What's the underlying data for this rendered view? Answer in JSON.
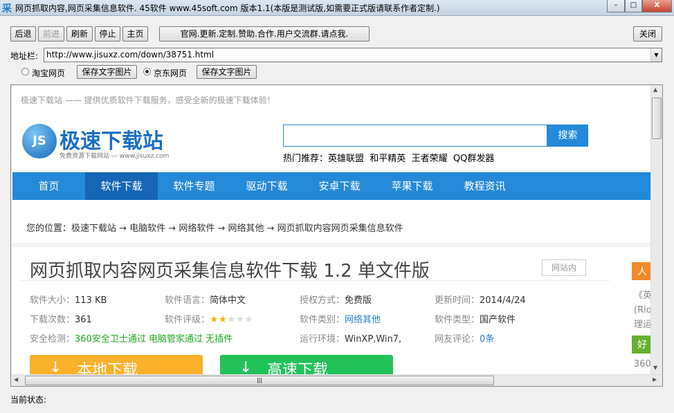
{
  "window": {
    "title": "网页抓取内容,网页采集信息软件. 45软件 www.45soft.com 版本1.1(本版是测试版,如需要正式版请联系作者定制.)",
    "icon": "采",
    "min": "–",
    "max": "□",
    "close": "X"
  },
  "toolbar": {
    "back": "后退",
    "forward": "前进",
    "refresh": "刷新",
    "stop": "停止",
    "home": "主页",
    "promo": "官网.更新.定制.赞助.合作.用户交流群.请点我.",
    "close": "关闭"
  },
  "address": {
    "label": "地址栏:",
    "value": "http://www.jisuxz.com/down/38751.html"
  },
  "options": {
    "taobao": "淘宝网页",
    "save1": "保存文字图片",
    "jd": "京东网页",
    "save2": "保存文字图片",
    "selected": "jd"
  },
  "page": {
    "tagline": "极速下载站 —— 提供优质软件下载服务，感受全新的极速下载体验！",
    "logo": {
      "badge": "JS",
      "name": "极速下载站",
      "sub": "免费资源下载网站 — www.jisuxz.com"
    },
    "search": {
      "placeholder": "",
      "button": "搜索"
    },
    "hot": {
      "label": "热门推荐：",
      "items": [
        "英雄联盟",
        "和平精英",
        "王者荣耀",
        "QQ群发器"
      ]
    },
    "nav": [
      "首页",
      "软件下载",
      "软件专题",
      "驱动下载",
      "安卓下载",
      "苹果下载",
      "教程资讯"
    ],
    "nav_active": 1,
    "breadcrumb": "您的位置：极速下载站 → 电脑软件 → 网络软件 → 网络其他 → 网页抓取内容网页采集信息软件",
    "title": "网页抓取内容网页采集信息软件下载 1.2 单文件版",
    "site_btn": "网站内",
    "info": [
      {
        "label": "软件大小：",
        "value": "113 KB"
      },
      {
        "label": "软件语言：",
        "value": "简体中文"
      },
      {
        "label": "授权方式：",
        "value": "免费版"
      },
      {
        "label": "更新时间：",
        "value": "2014/4/24"
      },
      {
        "label": "下载次数：",
        "value": "361"
      },
      {
        "label": "软件评级：",
        "value": ""
      },
      {
        "label": "软件类别：",
        "value": "网络其他"
      },
      {
        "label": "软件类型：",
        "value": "国产软件"
      },
      {
        "label": "安全检测：",
        "value": "360安全卫士通过 电脑管家通过 无插件"
      },
      {
        "label": "运行环境：",
        "value": "WinXP,Win7,"
      },
      {
        "label": "网友评论：",
        "value": "0条"
      }
    ],
    "rating": 2,
    "rating_max": 5,
    "download_local": "本地下载",
    "download_fast": "高速下载",
    "side": {
      "tag1": "人气",
      "text1": "《英",
      "text2": "(Rio",
      "text3": "理运",
      "tag2": "好评",
      "text4": "360"
    }
  },
  "status": {
    "label": "当前状态:"
  }
}
